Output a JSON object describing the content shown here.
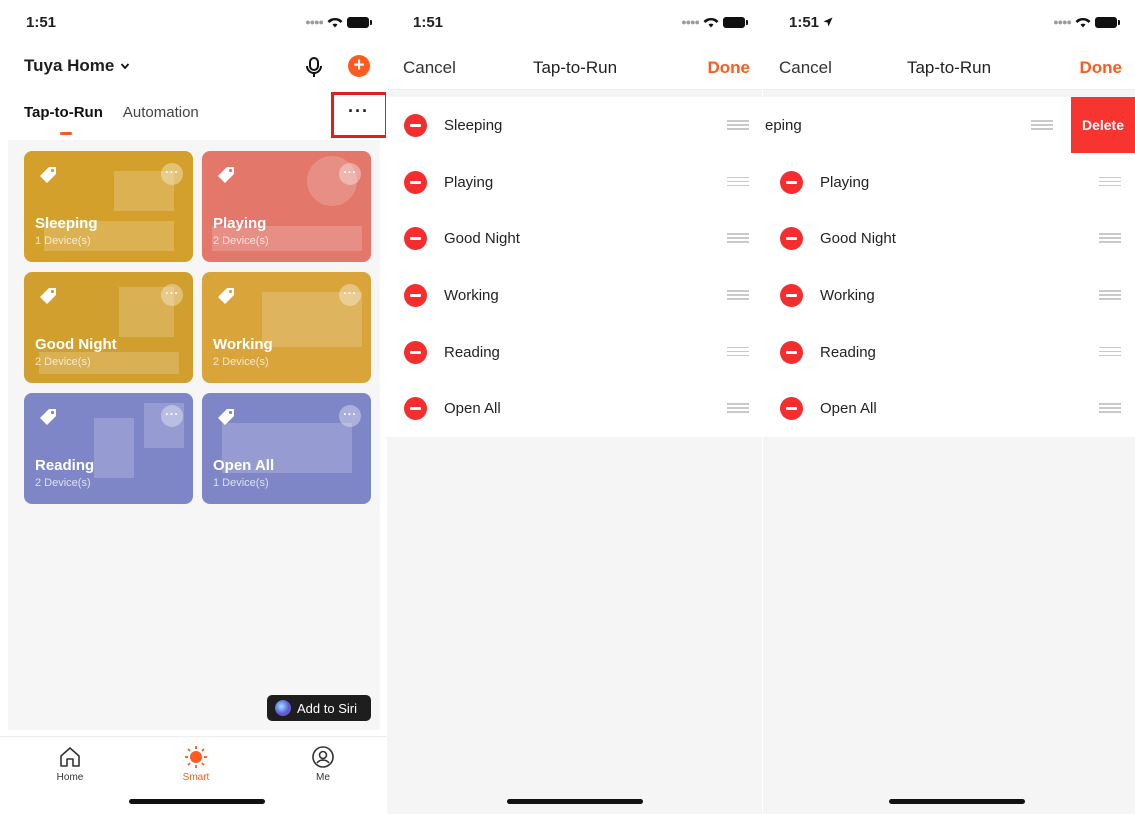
{
  "colors": {
    "accent": "#ff5a1f",
    "delete": "#f7342f",
    "highlight_box": "#e01e1e"
  },
  "panel1": {
    "status": {
      "time": "1:51"
    },
    "header": {
      "title": "Tuya Home"
    },
    "tabs": {
      "active": "Tap-to-Run",
      "inactive": "Automation"
    },
    "more_label": "···",
    "cards": [
      {
        "name": "Sleeping",
        "count": "1 Device(s)",
        "color": "#d4a02c"
      },
      {
        "name": "Playing",
        "count": "2 Device(s)",
        "color": "#e2776a"
      },
      {
        "name": "Good Night",
        "count": "2 Device(s)",
        "color": "#d19f2d"
      },
      {
        "name": "Working",
        "count": "2 Device(s)",
        "color": "#d9a43a"
      },
      {
        "name": "Reading",
        "count": "2 Device(s)",
        "color": "#7f86c8"
      },
      {
        "name": "Open All",
        "count": "1 Device(s)",
        "color": "#7f86c8"
      }
    ],
    "siri_label": "Add to Siri",
    "tabbar": {
      "home": "Home",
      "smart": "Smart",
      "me": "Me"
    }
  },
  "panel2": {
    "status": {
      "time": "1:51"
    },
    "nav": {
      "cancel": "Cancel",
      "title": "Tap-to-Run",
      "done": "Done"
    },
    "items": [
      "Sleeping",
      "Playing",
      "Good Night",
      "Working",
      "Reading",
      "Open All"
    ]
  },
  "panel3": {
    "status": {
      "time": "1:51"
    },
    "nav": {
      "cancel": "Cancel",
      "title": "Tap-to-Run",
      "done": "Done"
    },
    "swiped_label": "eping",
    "delete_label": "Delete",
    "items": [
      "Playing",
      "Good Night",
      "Working",
      "Reading",
      "Open All"
    ]
  }
}
